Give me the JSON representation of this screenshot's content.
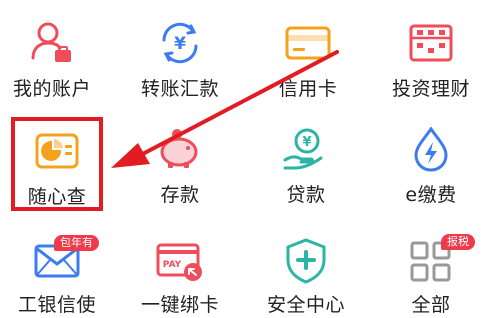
{
  "grid": {
    "items": [
      {
        "label": "我的账户",
        "icon": "account-icon"
      },
      {
        "label": "转账汇款",
        "icon": "yuan-transfer-icon"
      },
      {
        "label": "信用卡",
        "icon": "credit-card-icon"
      },
      {
        "label": "投资理财",
        "icon": "abacus-icon"
      },
      {
        "label": "随心查",
        "icon": "chart-card-icon"
      },
      {
        "label": "存款",
        "icon": "piggy-bank-icon"
      },
      {
        "label": "贷款",
        "icon": "hand-coin-icon"
      },
      {
        "label": "e缴费",
        "icon": "lightning-drop-icon"
      },
      {
        "label": "工银信使",
        "icon": "envelope-icon",
        "badge": "包年有"
      },
      {
        "label": "一键绑卡",
        "icon": "pay-card-icon"
      },
      {
        "label": "安全中心",
        "icon": "shield-plus-icon"
      },
      {
        "label": "全部",
        "icon": "grid-icon",
        "badge": "报税"
      }
    ]
  },
  "colors": {
    "red": "#ef4d5b",
    "blue": "#3b7cf0",
    "teal": "#2bb5a5",
    "orange": "#f4a21b",
    "annotation": "#e31b23"
  }
}
